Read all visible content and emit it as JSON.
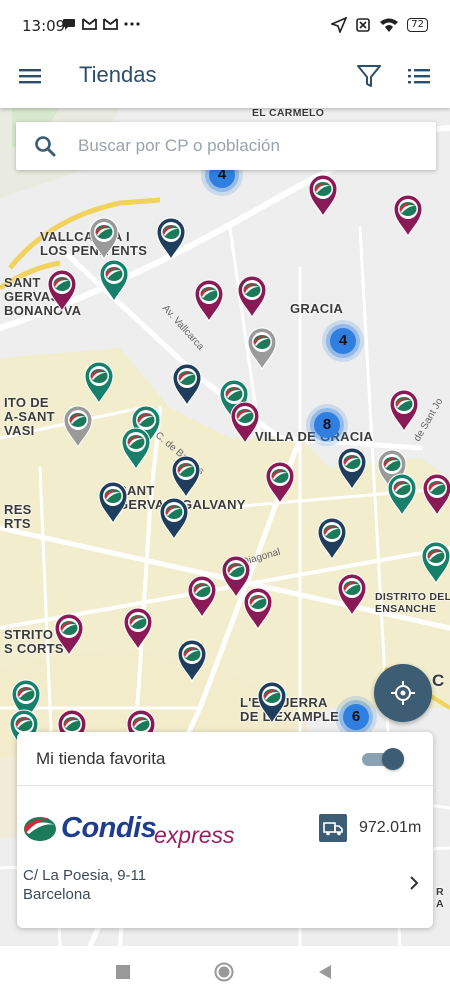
{
  "status_bar": {
    "time": "13:09",
    "battery": "72"
  },
  "app_bar": {
    "title": "Tiendas",
    "menu_icon": "menu-icon",
    "filter_icon": "filter-icon",
    "list_icon": "list-icon"
  },
  "search": {
    "placeholder": "Buscar por CP o población",
    "value": ""
  },
  "map": {
    "labels": {
      "el_carmelo": "EL CARMELO",
      "vallcarca": "VALLCARCA I\nLOS PENITENTS",
      "sant_gervasi_bonanova": "SANT\nGERVASI-\nBONANOVA",
      "gracia": "GRACIA",
      "sant_gervasi_galvany_left": "ITO DE\nA-SANT\nVASI",
      "villa_gracia": "VILLA DE GRACIA",
      "sant_gervasi_galvany": "SANT\nGERVASI-GALVANY",
      "les_corts_top": "RES\nRTS",
      "districte_ensanche": "DISTRITO DEL\nENSANCHE",
      "les_corts": "STRITO DE\nS CORTS",
      "dreta_eixample": "L'ESQUERRA\nDE L'EXAMPLE",
      "right_edge": "C",
      "right_edge_small": "R\nA"
    },
    "streets": {
      "vallcarca": "Av. Vallcarca",
      "balmes": "C. de Balmes",
      "diagonal": "Av. Diagonal",
      "sant_joan": "de Sant Jo"
    },
    "clusters": [
      "4",
      "4",
      "8",
      "6"
    ],
    "colors": {
      "maroon": "#8a1a55",
      "navy": "#1f3d5c",
      "green": "#16806a",
      "gray": "#9a9a9a",
      "cluster": "#2f7fe0"
    }
  },
  "card": {
    "favorite_label": "Mi tienda favorita",
    "favorite_on": true,
    "logo_text_1": "Condis",
    "logo_text_2": "express",
    "distance": "972.01m",
    "address_line1": "C/ La Poesia, 9-11",
    "address_line2": "Barcelona"
  }
}
